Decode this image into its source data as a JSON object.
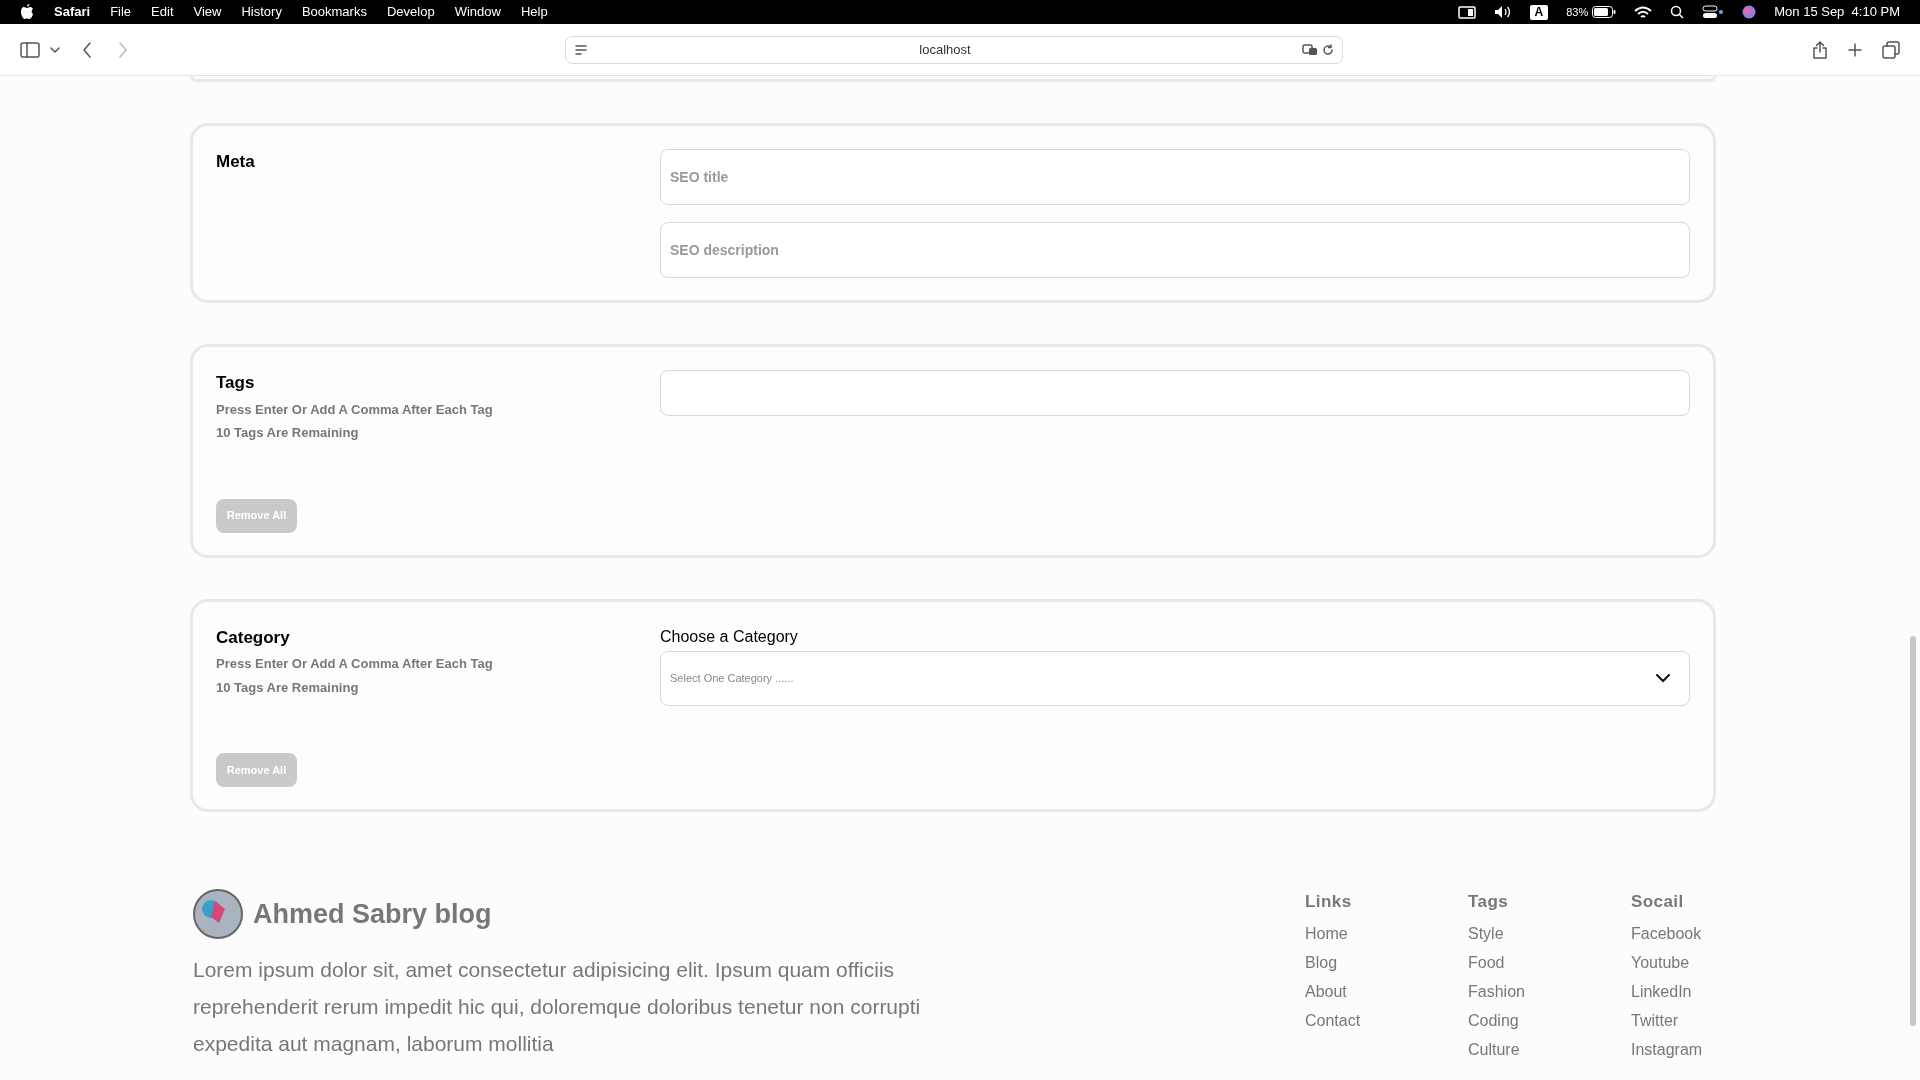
{
  "menu_bar": {
    "app": "Safari",
    "menus": [
      "File",
      "Edit",
      "View",
      "History",
      "Bookmarks",
      "Develop",
      "Window",
      "Help"
    ],
    "input_source": "A",
    "battery": "83%",
    "clock": "Mon 15 Sep  4:10 PM"
  },
  "browser": {
    "address": "localhost"
  },
  "sections": [
    {
      "kind": "meta",
      "title": "Meta",
      "fields": [
        {
          "placeholder": "SEO title"
        },
        {
          "placeholder": "SEO description"
        }
      ]
    },
    {
      "kind": "tags",
      "title": "Tags",
      "hints": [
        "Press Enter Or Add A Comma After Each Tag",
        "10 Tags Are Remaining"
      ],
      "button": {
        "label": "Remove All",
        "disabled": true
      }
    },
    {
      "kind": "category",
      "title": "Category",
      "hints": [
        "Press Enter Or Add A Comma After Each Tag",
        "10 Tags Are Remaining"
      ],
      "select_label": "Choose a Category",
      "select_placeholder": "Select One Category ......",
      "button": {
        "label": "Remove All",
        "disabled": true
      }
    }
  ],
  "footer": {
    "blog_name": "Ahmed Sabry blog",
    "description": "Lorem ipsum dolor sit, amet consectetur adipisicing elit. Ipsum quam officiis reprehenderit rerum impedit hic qui, doloremque doloribus tenetur non corrupti expedita aut magnam, laborum mollitia",
    "columns": [
      {
        "heading": "Links",
        "links": [
          "Home",
          "Blog",
          "About",
          "Contact"
        ]
      },
      {
        "heading": "Tags",
        "links": [
          "Style",
          "Food",
          "Fashion",
          "Coding",
          "Culture"
        ]
      },
      {
        "heading": "Socail",
        "links": [
          "Facebook",
          "Youtube",
          "LinkedIn",
          "Twitter",
          "Instagram"
        ]
      }
    ]
  }
}
